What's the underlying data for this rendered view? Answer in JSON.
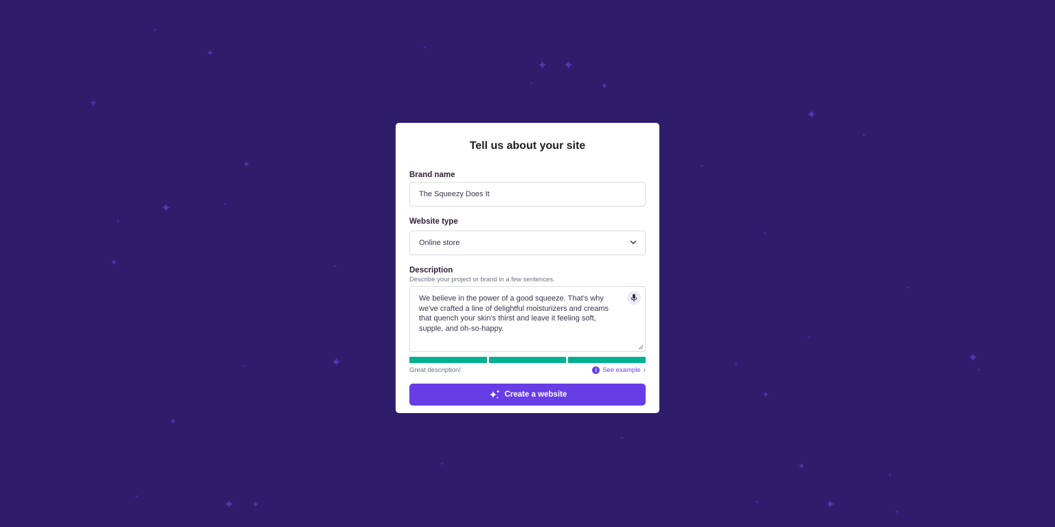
{
  "form": {
    "title": "Tell us about your site",
    "brand": {
      "label": "Brand name",
      "value": "The Squeezy Does It"
    },
    "website_type": {
      "label": "Website type",
      "selected": "Online store"
    },
    "description": {
      "label": "Description",
      "hint": "Describe your project or brand in a few sentences.",
      "value": "We believe in the power of a good squeeze. That's why we've crafted a line of delightful moisturizers and creams that quench your skin's thirst and leave it feeling soft, supple, and oh-so-happy.",
      "quality_text": "Great description!",
      "quality_segments_filled": 3,
      "quality_segments_total": 3,
      "see_example": "See example"
    },
    "submit_label": "Create a website"
  },
  "colors": {
    "background": "#2f1c6a",
    "accent": "#673de6",
    "meter": "#00b090"
  }
}
